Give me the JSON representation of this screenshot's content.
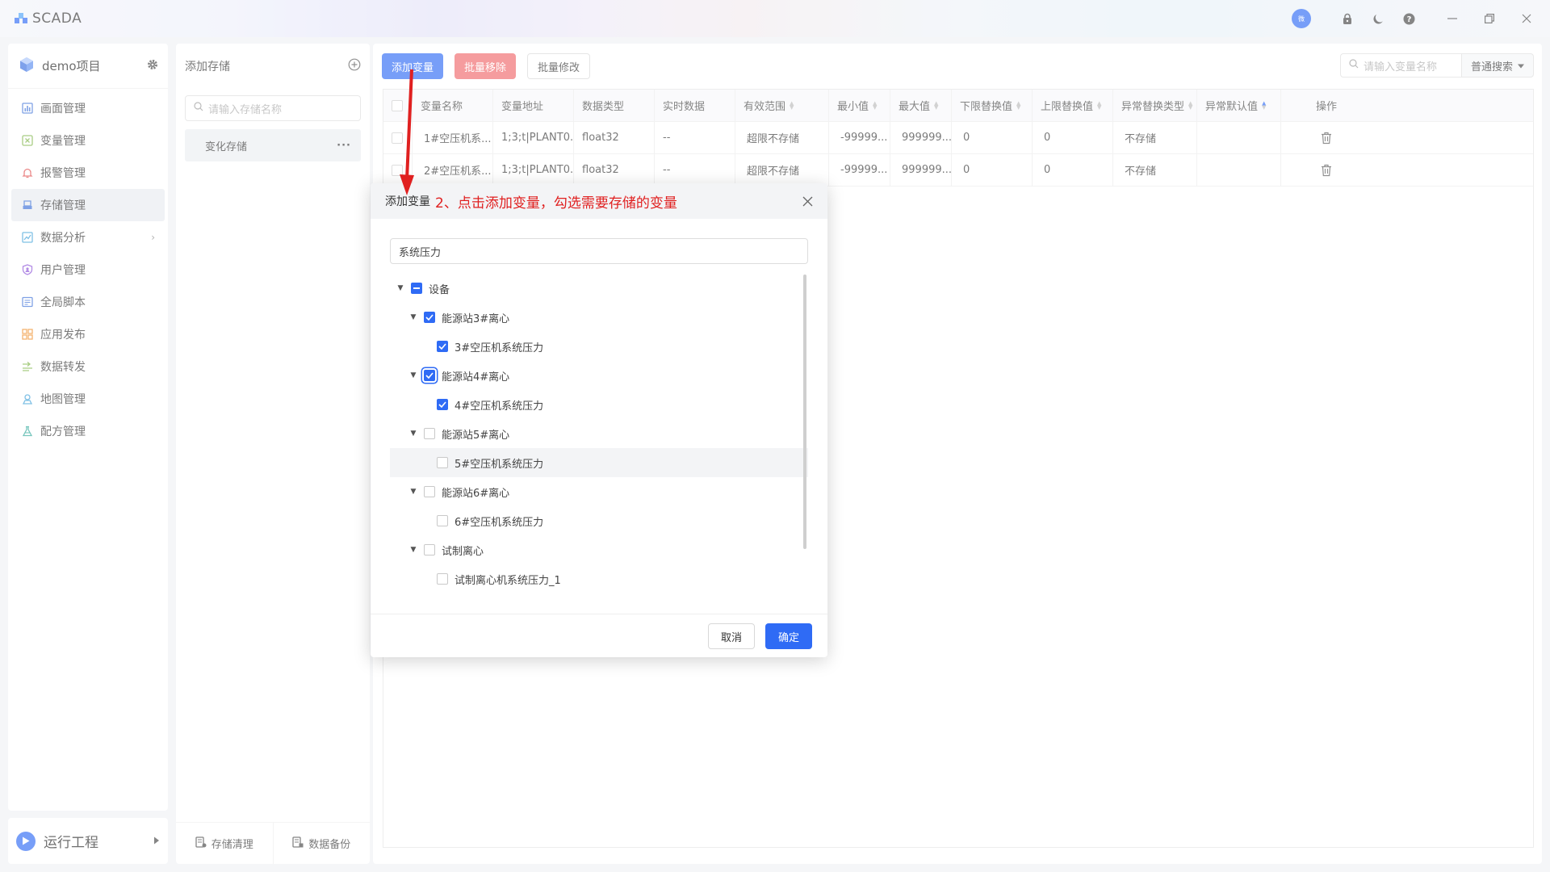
{
  "app": {
    "name": "SCADA"
  },
  "project": {
    "name": "demo项目"
  },
  "titlebar": {
    "avatar_text": "微"
  },
  "sidebar": {
    "items": [
      {
        "label": "画面管理",
        "icon": "chart-bar-icon",
        "color": "#3b6fd8"
      },
      {
        "label": "变量管理",
        "icon": "variable-icon",
        "color": "#7cb342"
      },
      {
        "label": "报警管理",
        "icon": "bell-icon",
        "color": "#e04a4a"
      },
      {
        "label": "存储管理",
        "icon": "storage-icon",
        "color": "#3b6fd8",
        "active": true
      },
      {
        "label": "数据分析",
        "icon": "analytics-icon",
        "color": "#3b9fd8",
        "has_submenu": true
      },
      {
        "label": "用户管理",
        "icon": "shield-user-icon",
        "color": "#8a4fd8"
      },
      {
        "label": "全局脚本",
        "icon": "script-icon",
        "color": "#3b6fd8"
      },
      {
        "label": "应用发布",
        "icon": "grid-icon",
        "color": "#f08a24"
      },
      {
        "label": "数据转发",
        "icon": "forward-icon",
        "color": "#7cb342"
      },
      {
        "label": "地图管理",
        "icon": "map-pin-icon",
        "color": "#3b9fd8"
      },
      {
        "label": "配方管理",
        "icon": "flask-icon",
        "color": "#2fa89a"
      }
    ],
    "run_label": "运行工程"
  },
  "storage": {
    "title": "添加存储",
    "search_placeholder": "请输入存储名称",
    "items": [
      {
        "label": "变化存储"
      }
    ],
    "footer": {
      "clean_label": "存储清理",
      "backup_label": "数据备份"
    }
  },
  "toolbar": {
    "add_label": "添加变量",
    "batch_remove_label": "批量移除",
    "batch_edit_label": "批量修改",
    "search_placeholder": "请输入变量名称",
    "search_mode": "普通搜索"
  },
  "table": {
    "columns": [
      "变量名称",
      "变量地址",
      "数据类型",
      "实时数据",
      "有效范围",
      "最小值",
      "最大值",
      "下限替换值",
      "上限替换值",
      "异常替换类型",
      "异常默认值",
      "操作"
    ],
    "rows": [
      [
        "1#空压机系...",
        "1;3;t|PLANT0...",
        "float32",
        "--",
        "超限不存储",
        "-99999...",
        "999999...",
        "0",
        "0",
        "不存储",
        ""
      ],
      [
        "2#空压机系...",
        "1;3;t|PLANT0...",
        "float32",
        "--",
        "超限不存储",
        "-99999...",
        "999999...",
        "0",
        "0",
        "不存储",
        ""
      ]
    ]
  },
  "modal": {
    "title": "添加变量",
    "annotation": "2、点击添加变量，勾选需要存储的变量",
    "search_value": "系统压力",
    "tree": [
      {
        "label": "设备",
        "level": 0,
        "state": "partial",
        "expandable": true
      },
      {
        "label": "能源站3#离心",
        "level": 1,
        "state": "checked",
        "expandable": true
      },
      {
        "label": "3#空压机系统压力",
        "level": 2,
        "state": "checked"
      },
      {
        "label": "能源站4#离心",
        "level": 1,
        "state": "checked",
        "expandable": true,
        "focus": true
      },
      {
        "label": "4#空压机系统压力",
        "level": 2,
        "state": "checked"
      },
      {
        "label": "能源站5#离心",
        "level": 1,
        "state": "unchecked",
        "expandable": true
      },
      {
        "label": "5#空压机系统压力",
        "level": 2,
        "state": "unchecked",
        "hover": true
      },
      {
        "label": "能源站6#离心",
        "level": 1,
        "state": "unchecked",
        "expandable": true
      },
      {
        "label": "6#空压机系统压力",
        "level": 2,
        "state": "unchecked"
      },
      {
        "label": "试制离心",
        "level": 1,
        "state": "unchecked",
        "expandable": true
      },
      {
        "label": "试制离心机系统压力_1",
        "level": 2,
        "state": "unchecked"
      }
    ],
    "cancel_label": "取消",
    "ok_label": "确定"
  },
  "colors": {
    "primary": "#2f6bf5",
    "danger": "#f0676a",
    "annotation": "#e02020"
  }
}
